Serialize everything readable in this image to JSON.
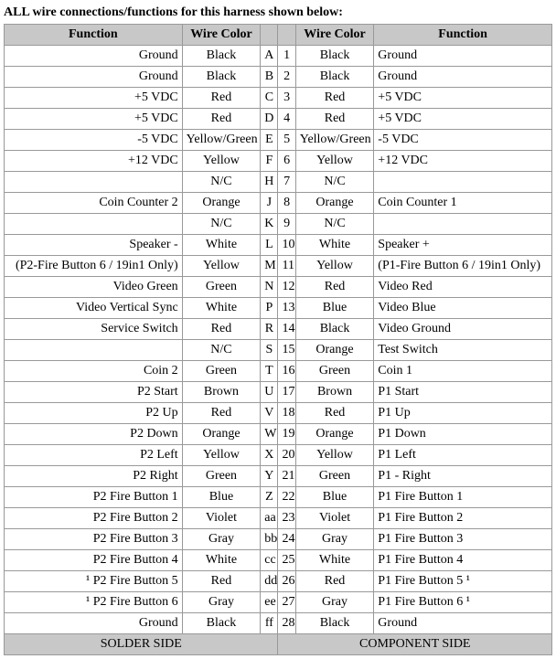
{
  "title": "ALL wire connections/functions for this harness shown below:",
  "headers": {
    "funcL": "Function",
    "colorL": "Wire Color",
    "colorR": "Wire Color",
    "funcR": "Function"
  },
  "footer": {
    "left": "SOLDER SIDE",
    "right": "COMPONENT SIDE"
  },
  "rows": [
    {
      "fl": "Ground",
      "cl": "Black",
      "pl": "A",
      "pr": "1",
      "cr": "Black",
      "fr": "Ground"
    },
    {
      "fl": "Ground",
      "cl": "Black",
      "pl": "B",
      "pr": "2",
      "cr": "Black",
      "fr": "Ground"
    },
    {
      "fl": "+5 VDC",
      "cl": "Red",
      "pl": "C",
      "pr": "3",
      "cr": "Red",
      "fr": "+5 VDC"
    },
    {
      "fl": "+5 VDC",
      "cl": "Red",
      "pl": "D",
      "pr": "4",
      "cr": "Red",
      "fr": "+5 VDC"
    },
    {
      "fl": "-5 VDC",
      "cl": "Yellow/Green",
      "pl": "E",
      "pr": "5",
      "cr": "Yellow/Green",
      "fr": "-5 VDC"
    },
    {
      "fl": "+12 VDC",
      "cl": "Yellow",
      "pl": "F",
      "pr": "6",
      "cr": "Yellow",
      "fr": "+12 VDC"
    },
    {
      "fl": "",
      "cl": "N/C",
      "pl": "H",
      "pr": "7",
      "cr": "N/C",
      "fr": ""
    },
    {
      "fl": "Coin Counter 2",
      "cl": "Orange",
      "pl": "J",
      "pr": "8",
      "cr": "Orange",
      "fr": "Coin Counter 1"
    },
    {
      "fl": "",
      "cl": "N/C",
      "pl": "K",
      "pr": "9",
      "cr": "N/C",
      "fr": ""
    },
    {
      "fl": "Speaker -",
      "cl": "White",
      "pl": "L",
      "pr": "10",
      "cr": "White",
      "fr": "Speaker +"
    },
    {
      "fl": "(P2-Fire Button 6 / 19in1 Only)",
      "cl": "Yellow",
      "pl": "M",
      "pr": "11",
      "cr": "Yellow",
      "fr": "(P1-Fire Button 6 / 19in1 Only)"
    },
    {
      "fl": "Video Green",
      "cl": "Green",
      "pl": "N",
      "pr": "12",
      "cr": "Red",
      "fr": "Video Red"
    },
    {
      "fl": "Video Vertical Sync",
      "cl": "White",
      "pl": "P",
      "pr": "13",
      "cr": "Blue",
      "fr": "Video Blue"
    },
    {
      "fl": "Service Switch",
      "cl": "Red",
      "pl": "R",
      "pr": "14",
      "cr": "Black",
      "fr": "Video Ground"
    },
    {
      "fl": "",
      "cl": "N/C",
      "pl": "S",
      "pr": "15",
      "cr": "Orange",
      "fr": "Test Switch"
    },
    {
      "fl": "Coin 2",
      "cl": "Green",
      "pl": "T",
      "pr": "16",
      "cr": "Green",
      "fr": "Coin 1"
    },
    {
      "fl": "P2 Start",
      "cl": "Brown",
      "pl": "U",
      "pr": "17",
      "cr": "Brown",
      "fr": "P1 Start"
    },
    {
      "fl": "P2 Up",
      "cl": "Red",
      "pl": "V",
      "pr": "18",
      "cr": "Red",
      "fr": "P1 Up"
    },
    {
      "fl": "P2 Down",
      "cl": "Orange",
      "pl": "W",
      "pr": "19",
      "cr": "Orange",
      "fr": "P1 Down"
    },
    {
      "fl": "P2 Left",
      "cl": "Yellow",
      "pl": "X",
      "pr": "20",
      "cr": "Yellow",
      "fr": "P1 Left"
    },
    {
      "fl": "P2 Right",
      "cl": "Green",
      "pl": "Y",
      "pr": "21",
      "cr": "Green",
      "fr": "P1 - Right"
    },
    {
      "fl": "P2 Fire Button 1",
      "cl": "Blue",
      "pl": "Z",
      "pr": "22",
      "cr": "Blue",
      "fr": "P1 Fire Button 1"
    },
    {
      "fl": "P2 Fire Button 2",
      "cl": "Violet",
      "pl": "aa",
      "pr": "23",
      "cr": "Violet",
      "fr": "P1 Fire Button 2"
    },
    {
      "fl": "P2 Fire Button 3",
      "cl": "Gray",
      "pl": "bb",
      "pr": "24",
      "cr": "Gray",
      "fr": "P1 Fire Button 3"
    },
    {
      "fl": "P2 Fire Button 4",
      "cl": "White",
      "pl": "cc",
      "pr": "25",
      "cr": "White",
      "fr": "P1 Fire Button 4"
    },
    {
      "fl": "¹ P2 Fire Button 5",
      "cl": "Red",
      "pl": "dd",
      "pr": "26",
      "cr": "Red",
      "fr": "P1 Fire Button 5 ¹"
    },
    {
      "fl": "¹ P2 Fire Button 6",
      "cl": "Gray",
      "pl": "ee",
      "pr": "27",
      "cr": "Gray",
      "fr": "P1 Fire Button 6 ¹"
    },
    {
      "fl": "Ground",
      "cl": "Black",
      "pl": "ff",
      "pr": "28",
      "cr": "Black",
      "fr": "Ground"
    }
  ]
}
